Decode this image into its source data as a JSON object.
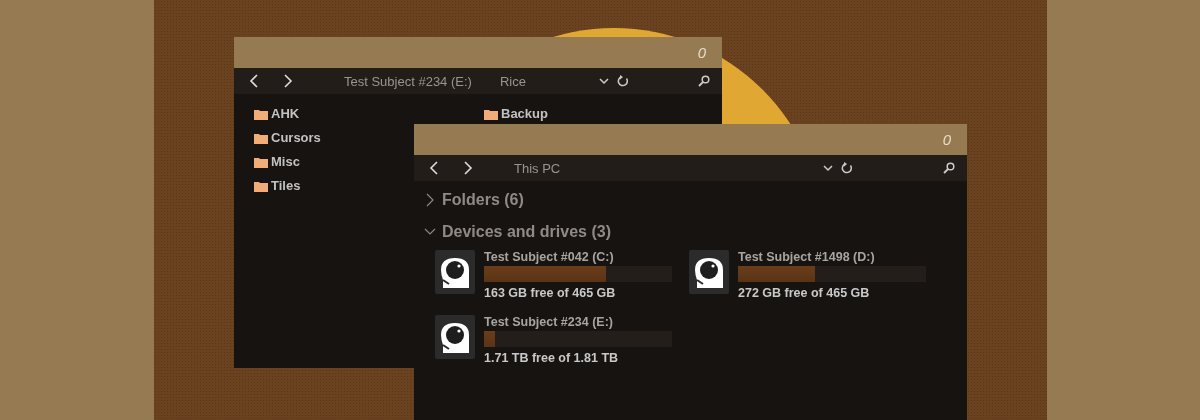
{
  "windows": [
    {
      "title": "0",
      "address": [
        "Test Subject #234 (E:)",
        "Rice"
      ],
      "folders": [
        {
          "name": "AHK"
        },
        {
          "name": "Cursors"
        },
        {
          "name": "Misc"
        },
        {
          "name": "Tiles"
        },
        {
          "name": "Backup"
        }
      ]
    },
    {
      "title": "0",
      "address": [
        "This PC"
      ],
      "sections": [
        {
          "title": "Folders (6)",
          "expanded": false
        },
        {
          "title": "Devices and drives (3)",
          "expanded": true,
          "drives": [
            {
              "name": "Test Subject #042 (C:)",
              "level": 0.65,
              "free": "163 GB free of 465 GB"
            },
            {
              "name": "Test Subject #1498 (D:)",
              "level": 0.41,
              "free": "272 GB free of 465 GB"
            },
            {
              "name": "Test Subject #234 (E:)",
              "level": 0.06,
              "free": "1.71 TB free of 1.81 TB"
            }
          ]
        }
      ]
    }
  ]
}
